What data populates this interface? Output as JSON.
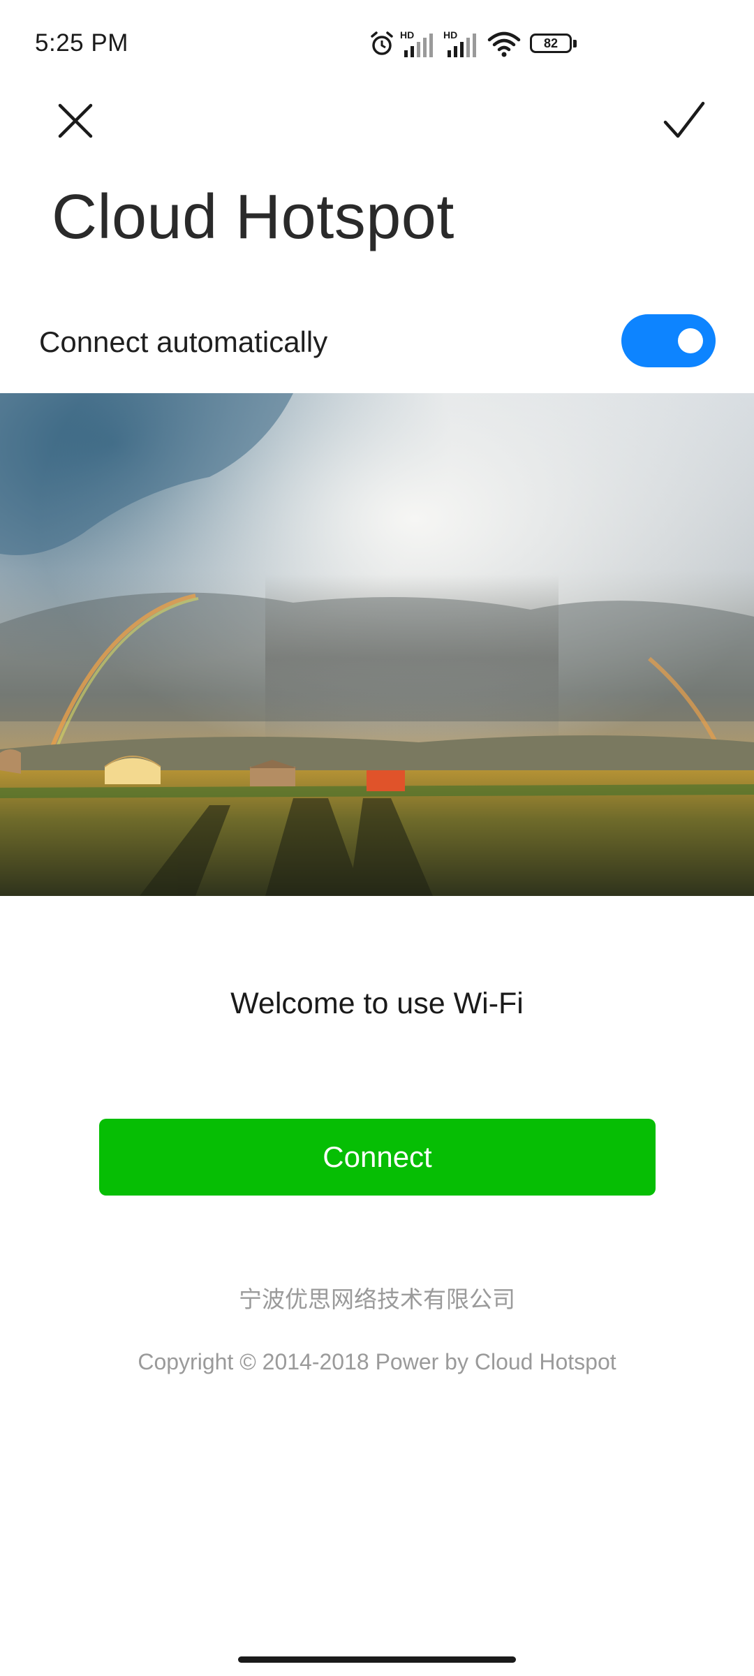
{
  "status_bar": {
    "time": "5:25 PM",
    "icons": [
      "alarm-icon",
      "signal-hd-icon",
      "signal-hd-icon",
      "wifi-icon",
      "battery-icon"
    ],
    "sim1_label": "HD",
    "sim2_label": "HD",
    "battery_level": "82"
  },
  "header": {
    "close_icon": "close-icon",
    "confirm_icon": "checkmark-icon",
    "title": "Cloud Hotspot"
  },
  "settings": {
    "auto_connect_label": "Connect automatically",
    "auto_connect_enabled": true,
    "toggle_color": "#0d84ff"
  },
  "portal": {
    "banner_alt": "banner-image",
    "welcome_text": "Welcome to use Wi-Fi",
    "connect_label": "Connect",
    "connect_color": "#06be04",
    "company_name": "宁波优思网络技术有限公司",
    "copyright": "Copyright © 2014-2018 Power by Cloud Hotspot"
  }
}
